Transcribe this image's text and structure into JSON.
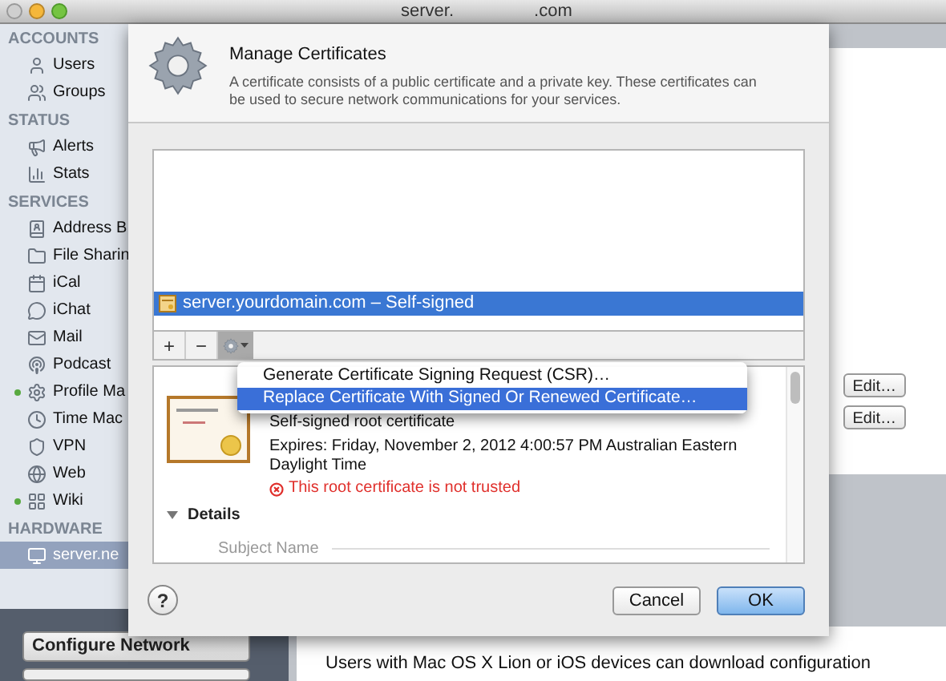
{
  "window": {
    "title_parts": [
      "server.",
      ".com"
    ]
  },
  "sidebar": {
    "sections": [
      {
        "heading": "ACCOUNTS",
        "items": [
          {
            "label": "Users",
            "selected": false
          },
          {
            "label": "Groups",
            "selected": false
          }
        ]
      },
      {
        "heading": "STATUS",
        "items": [
          {
            "label": "Alerts",
            "selected": false
          },
          {
            "label": "Stats",
            "selected": false
          }
        ]
      },
      {
        "heading": "SERVICES",
        "items": [
          {
            "label": "Address B",
            "selected": false,
            "running": false
          },
          {
            "label": "File Sharin",
            "selected": false,
            "running": false
          },
          {
            "label": "iCal",
            "selected": false,
            "running": false
          },
          {
            "label": "iChat",
            "selected": false,
            "running": false
          },
          {
            "label": "Mail",
            "selected": false,
            "running": false
          },
          {
            "label": "Podcast",
            "selected": false,
            "running": false
          },
          {
            "label": "Profile Ma",
            "selected": false,
            "running": true
          },
          {
            "label": "Time Mac",
            "selected": false,
            "running": false
          },
          {
            "label": "VPN",
            "selected": false,
            "running": false
          },
          {
            "label": "Web",
            "selected": false,
            "running": false
          },
          {
            "label": "Wiki",
            "selected": false,
            "running": true
          }
        ]
      },
      {
        "heading": "HARDWARE",
        "items": [
          {
            "label": "server.ne",
            "selected": true
          }
        ]
      }
    ],
    "buttons": [
      "Configure Network"
    ]
  },
  "main": {
    "edit_buttons": [
      "Edit…",
      "Edit…"
    ],
    "note": "Users with Mac OS X Lion or iOS devices can download configuration"
  },
  "sheet": {
    "title": "Manage Certificates",
    "description": "A certificate consists of a public certificate and a private key. These certificates can be used to secure network communications for your services.",
    "certificates": [
      {
        "label": "server.yourdomain.com – Self-signed",
        "selected": true
      }
    ],
    "toolbar": {
      "add": "+",
      "remove": "−",
      "action_open": true
    },
    "menu": [
      {
        "label": "Generate Certificate Signing Request (CSR)…",
        "selected": false
      },
      {
        "label": "Replace Certificate With Signed Or Renewed Certificate…",
        "selected": true
      }
    ],
    "detail": {
      "type": "Self-signed root certificate",
      "expires": "Expires: Friday, November 2, 2012 4:00:57 PM Australian Eastern Daylight Time",
      "warning": "This root certificate is not trusted",
      "details": {
        "label": "Details",
        "expanded": true,
        "sections": [
          "Subject Name"
        ]
      }
    },
    "help": "?",
    "buttons": [
      {
        "label": "Cancel",
        "default": false
      },
      {
        "label": "OK",
        "default": true
      }
    ]
  }
}
